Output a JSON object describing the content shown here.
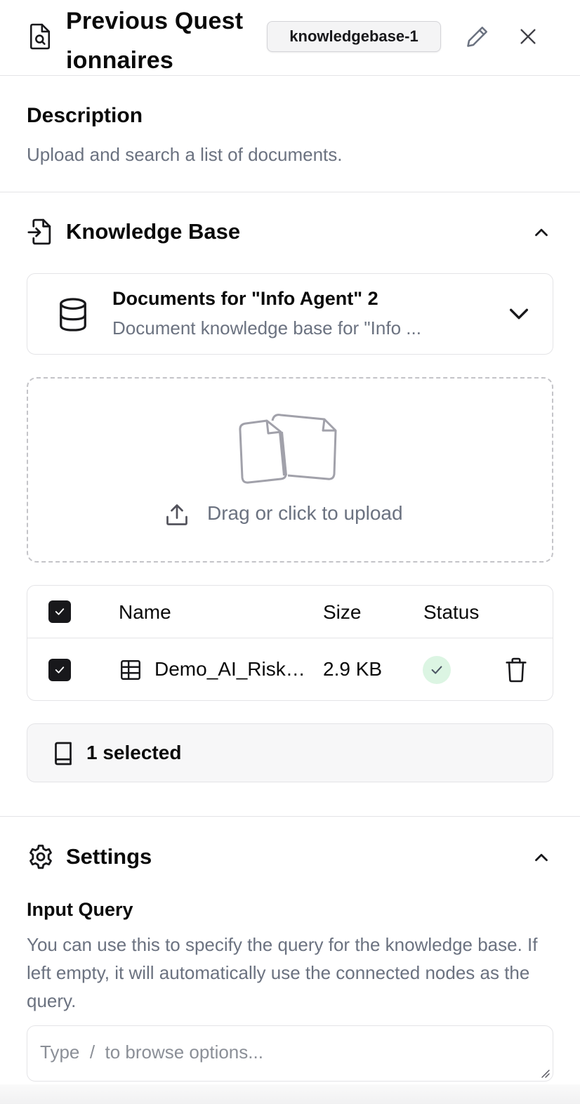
{
  "header": {
    "title": "Previous Questionnaires",
    "badge": "knowledgebase-1",
    "icons": {
      "node": "document-search-icon",
      "edit": "pencil-icon",
      "close": "close-icon"
    }
  },
  "description": {
    "heading": "Description",
    "text": "Upload and search a list of documents."
  },
  "knowledge_base": {
    "heading": "Knowledge Base",
    "selected_kb": {
      "name": "Documents for \"Info Agent\" 2",
      "subtitle": "Document knowledge base for \"Info ..."
    },
    "upload": {
      "label": "Drag or click to upload"
    },
    "table": {
      "columns": [
        "Name",
        "Size",
        "Status"
      ],
      "rows": [
        {
          "name": "Demo_AI_Risk_...",
          "size": "2.9 KB",
          "status": "done",
          "checked": true
        }
      ]
    },
    "selected_summary": "1 selected"
  },
  "settings": {
    "heading": "Settings",
    "input_query": {
      "label": "Input Query",
      "help": "You can use this to specify the query for the knowledge base. If left empty, it will automatically use the connected nodes as the query.",
      "value": "",
      "placeholder": "Type  /  to browse options..."
    }
  },
  "colors": {
    "text": "#0a0a0a",
    "muted": "#6b7280",
    "border": "#e4e4e7",
    "checkbox": "#18181b",
    "status_bg": "#dcf5e3",
    "status_fg": "#4b5563"
  }
}
